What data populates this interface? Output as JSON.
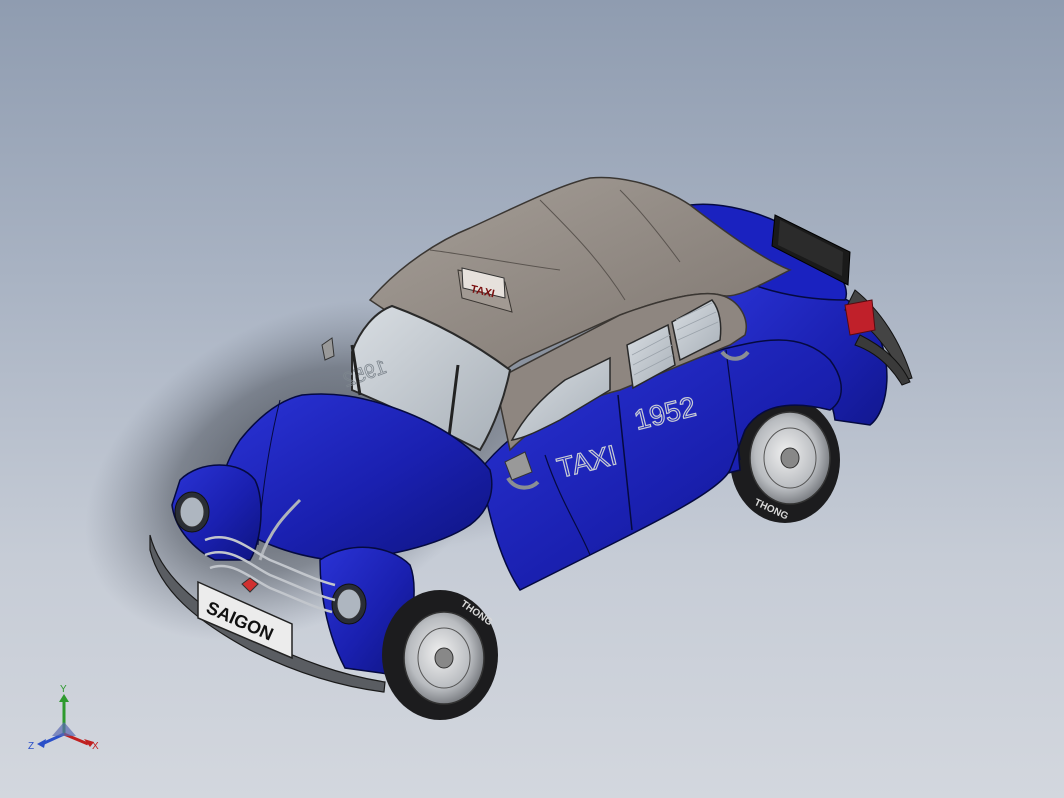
{
  "model": {
    "roof_sign": "TAXI",
    "door_text_1": "TAXI",
    "door_text_2": "1952",
    "windshield_text": "1952",
    "front_plate": "SAIGON",
    "tire_text": "THONG"
  },
  "triad": {
    "y_label": "Y",
    "x_label": "X",
    "z_label": "Z"
  },
  "colors": {
    "body": "#1a1fb4",
    "roof": "#8e8680",
    "background_top": "#8f9cb0",
    "background_bottom": "#d3d7de",
    "tail_light": "#c0202a"
  }
}
